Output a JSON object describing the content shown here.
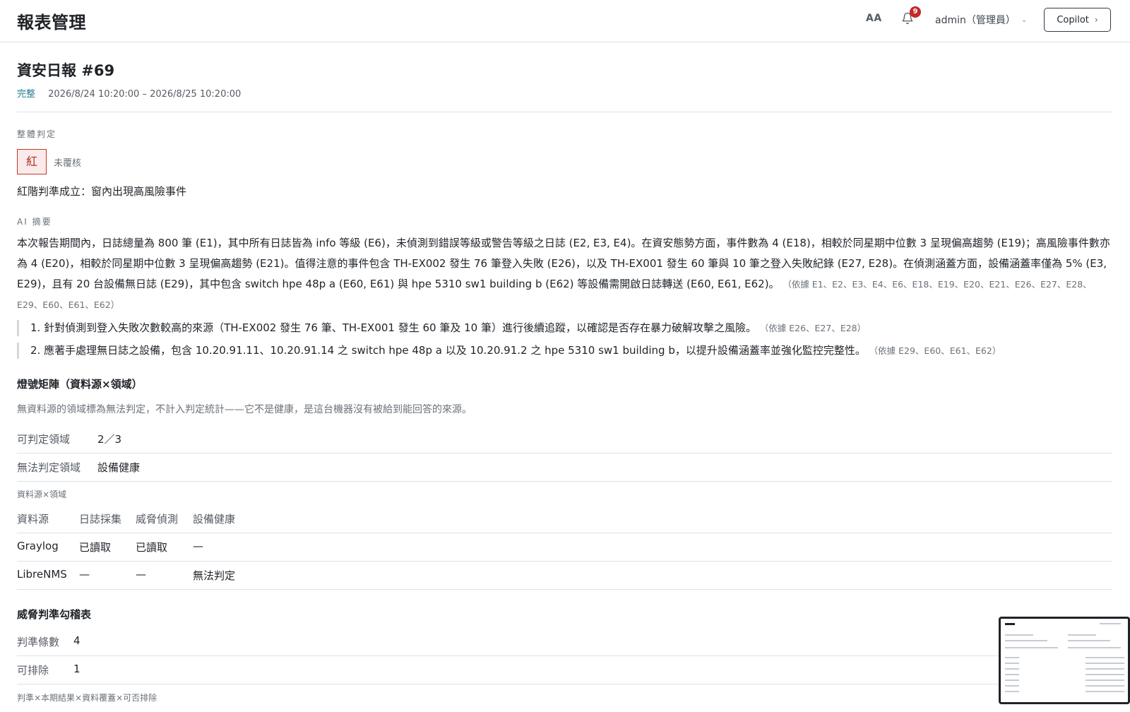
{
  "header": {
    "app_title": "報表管理",
    "font_toggle": "AA",
    "notification_count": "9",
    "user": "admin（管理員）",
    "copilot_label": "Copilot"
  },
  "report": {
    "title": "資安日報 #69",
    "status": "完整",
    "period": "2026/8/24 10:20:00 – 2026/8/25 10:20:00"
  },
  "verdict": {
    "section_label": "整體判定",
    "level": "紅",
    "review_status": "未覆核",
    "reason": "紅階判準成立：窗內出現高風險事件"
  },
  "ai_summary": {
    "section_label": "AI 摘要",
    "text": "本次報告期間內，日誌總量為 800 筆 (E1)，其中所有日誌皆為 info 等級 (E6)，未偵測到錯誤等級或警告等級之日誌 (E2, E3, E4)。在資安態勢方面，事件數為 4 (E18)，相較於同星期中位數 3 呈現偏高趨勢 (E19)；高風險事件數亦為 4 (E20)，相較於同星期中位數 3 呈現偏高趨勢 (E21)。值得注意的事件包含 TH-EX002 發生 76 筆登入失敗 (E26)，以及 TH-EX001 發生 60 筆與 10 筆之登入失敗紀錄 (E27, E28)。在偵測涵蓋方面，設備涵蓋率僅為 5% (E3, E29)，且有 20 台設備無日誌 (E29)，其中包含 switch hpe 48p a (E60, E61) 與 hpe 5310 sw1 building b (E62) 等設備需開啟日誌轉送 (E60, E61, E62)。",
    "evidence": "（依據 E1、E2、E3、E4、E6、E18、E19、E20、E21、E26、E27、E28、E29、E60、E61、E62）",
    "recommendations": [
      {
        "text": "1. 針對偵測到登入失敗次數較高的來源（TH-EX002 發生 76 筆、TH-EX001 發生 60 筆及 10 筆）進行後續追蹤，以確認是否存在暴力破解攻擊之風險。",
        "evidence": "（依據 E26、E27、E28）"
      },
      {
        "text": "2. 應著手處理無日誌之設備，包含 10.20.91.11、10.20.91.14 之 switch hpe 48p a 以及 10.20.91.2 之 hpe 5310 sw1 building b，以提升設備涵蓋率並強化監控完整性。",
        "evidence": "（依據 E29、E60、E61、E62）"
      }
    ]
  },
  "lamp_matrix": {
    "title": "燈號矩陣（資料源×領域）",
    "note": "無資料源的領域標為無法判定，不計入判定統計——它不是健康，是這台機器沒有被給到能回答的來源。",
    "judgeable_label": "可判定領域",
    "judgeable_value": "2／3",
    "unjudgeable_label": "無法判定領域",
    "unjudgeable_value": "設備健康",
    "matrix_label": "資料源×領域",
    "headers": [
      "資料源",
      "日誌採集",
      "威脅偵測",
      "設備健康"
    ],
    "rows": [
      [
        "Graylog",
        "已讀取",
        "已讀取",
        "—"
      ],
      [
        "LibreNMS",
        "—",
        "—",
        "無法判定"
      ]
    ]
  },
  "threat_checklist": {
    "title": "威脅判準勾稽表",
    "criteria_label": "判準條數",
    "criteria_value": "4",
    "excludable_label": "可排除",
    "excludable_value": "1",
    "partial_next": "判準×本期結果×資料覆蓋×可否排除"
  }
}
